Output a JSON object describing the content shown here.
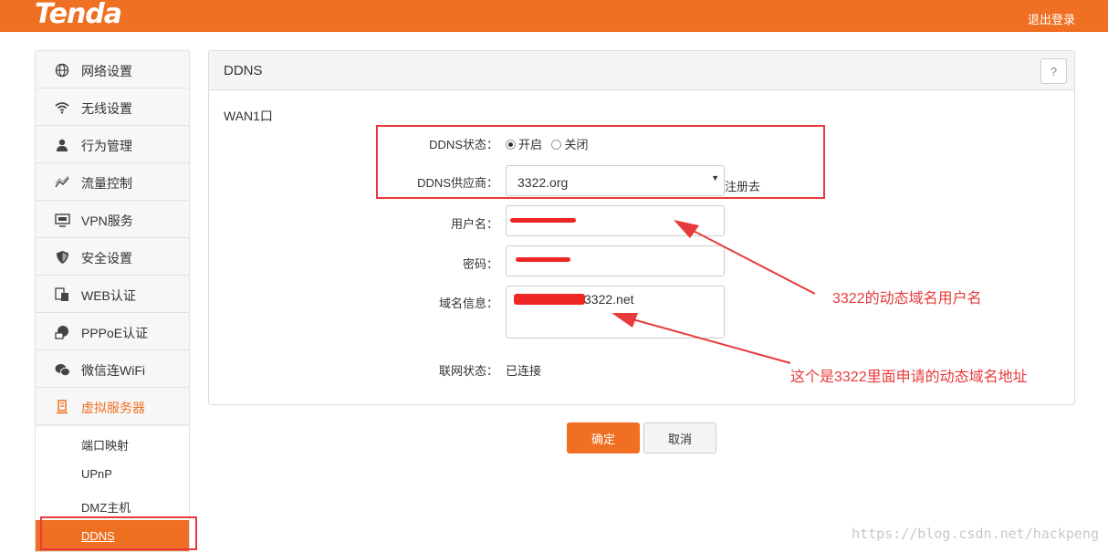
{
  "header": {
    "logo": "Tenda",
    "logout": "退出登录",
    "brand_color": "#ef7023"
  },
  "sidebar": {
    "items": [
      {
        "label": "网络设置",
        "icon": "globe-icon"
      },
      {
        "label": "无线设置",
        "icon": "wifi-icon"
      },
      {
        "label": "行为管理",
        "icon": "user-icon"
      },
      {
        "label": "流量控制",
        "icon": "traffic-icon"
      },
      {
        "label": "VPN服务",
        "icon": "vpn-icon"
      },
      {
        "label": "安全设置",
        "icon": "shield-icon"
      },
      {
        "label": "WEB认证",
        "icon": "web-auth-icon"
      },
      {
        "label": "PPPoE认证",
        "icon": "pppoe-icon"
      },
      {
        "label": "微信连WiFi",
        "icon": "wechat-icon"
      },
      {
        "label": "虚拟服务器",
        "icon": "server-icon",
        "active": true
      }
    ],
    "sub_items": [
      {
        "label": "端口映射"
      },
      {
        "label": "UPnP"
      },
      {
        "label": "DMZ主机"
      },
      {
        "label": "DDNS",
        "active": true
      }
    ]
  },
  "panel": {
    "title": "DDNS",
    "help": "?",
    "section": "WAN1口",
    "status_label": "DDNS状态：",
    "status_on": "开启",
    "status_off": "关闭",
    "status_selected": "开启",
    "provider_label": "DDNS供应商：",
    "provider_value": "3322.org",
    "register_link": "注册去",
    "username_label": "用户名：",
    "password_label": "密码：",
    "domain_label": "域名信息：",
    "domain_value": "3322.net",
    "conn_label": "联网状态：",
    "conn_value": "已连接"
  },
  "buttons": {
    "ok": "确定",
    "cancel": "取消"
  },
  "annotations": {
    "note1": "3322的动态域名用户名",
    "note2": "这个是3322里面申请的动态域名地址",
    "color": "#e83a3a"
  },
  "watermark": "https://blog.csdn.net/hackpeng"
}
